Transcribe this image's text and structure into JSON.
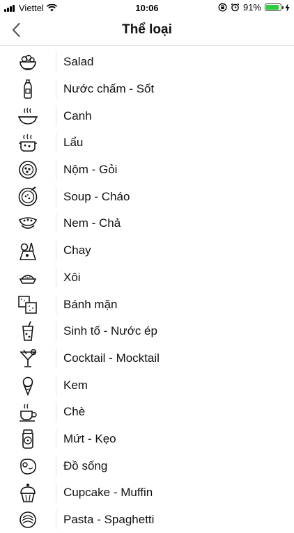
{
  "status": {
    "carrier": "Viettel",
    "time": "10:06",
    "battery_percent": "91%",
    "battery_level": 0.91,
    "battery_color": "#2ecc40"
  },
  "header": {
    "title": "Thể loại",
    "back_icon": "chevron-left-icon"
  },
  "categories": [
    {
      "label": "Salad",
      "icon": "salad-bowl-icon"
    },
    {
      "label": "Nước chấm - Sốt",
      "icon": "sauce-bottle-icon"
    },
    {
      "label": "Canh",
      "icon": "soup-bowl-icon"
    },
    {
      "label": "Lẩu",
      "icon": "hotpot-icon"
    },
    {
      "label": "Nộm - Gỏi",
      "icon": "salad-plate-icon"
    },
    {
      "label": "Soup - Cháo",
      "icon": "porridge-icon"
    },
    {
      "label": "Nem - Chả",
      "icon": "spring-roll-icon"
    },
    {
      "label": "Chay",
      "icon": "vegetable-icon"
    },
    {
      "label": "Xôi",
      "icon": "sticky-rice-icon"
    },
    {
      "label": "Bánh mặn",
      "icon": "cracker-icon"
    },
    {
      "label": "Sinh tố - Nước ép",
      "icon": "smoothie-icon"
    },
    {
      "label": "Cocktail - Mocktail",
      "icon": "cocktail-icon"
    },
    {
      "label": "Kem",
      "icon": "ice-cream-icon"
    },
    {
      "label": "Chè",
      "icon": "tea-cup-icon"
    },
    {
      "label": "Mứt - Kẹo",
      "icon": "jam-jar-icon"
    },
    {
      "label": "Đồ sống",
      "icon": "raw-meat-icon"
    },
    {
      "label": "Cupcake - Muffin",
      "icon": "cupcake-icon"
    },
    {
      "label": "Pasta - Spaghetti",
      "icon": "pasta-icon"
    }
  ]
}
